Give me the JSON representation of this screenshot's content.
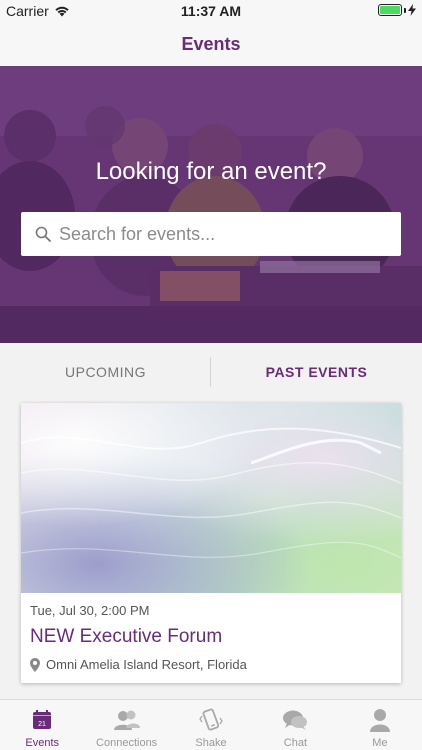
{
  "status_bar": {
    "carrier": "Carrier",
    "time": "11:37 AM",
    "battery_level": 1.0
  },
  "nav": {
    "title": "Events"
  },
  "hero": {
    "heading": "Looking for an event?",
    "search_placeholder": "Search for events..."
  },
  "tabs": {
    "upcoming": "UPCOMING",
    "past": "PAST EVENTS",
    "selected": "past"
  },
  "event": {
    "date": "Tue, Jul 30, 2:00 PM",
    "title": "NEW Executive Forum",
    "location": "Omni Amelia Island Resort, Florida"
  },
  "tabbar": {
    "items": [
      {
        "label": "Events",
        "icon": "calendar-icon",
        "badge": "21",
        "active": true
      },
      {
        "label": "Connections",
        "icon": "people-icon",
        "active": false
      },
      {
        "label": "Shake",
        "icon": "shake-phone-icon",
        "active": false
      },
      {
        "label": "Chat",
        "icon": "chat-bubbles-icon",
        "active": false
      },
      {
        "label": "Me",
        "icon": "person-icon",
        "active": false
      }
    ]
  },
  "colors": {
    "brand": "#6a2c7a",
    "battery": "#4cd964",
    "inactive": "#999999"
  }
}
